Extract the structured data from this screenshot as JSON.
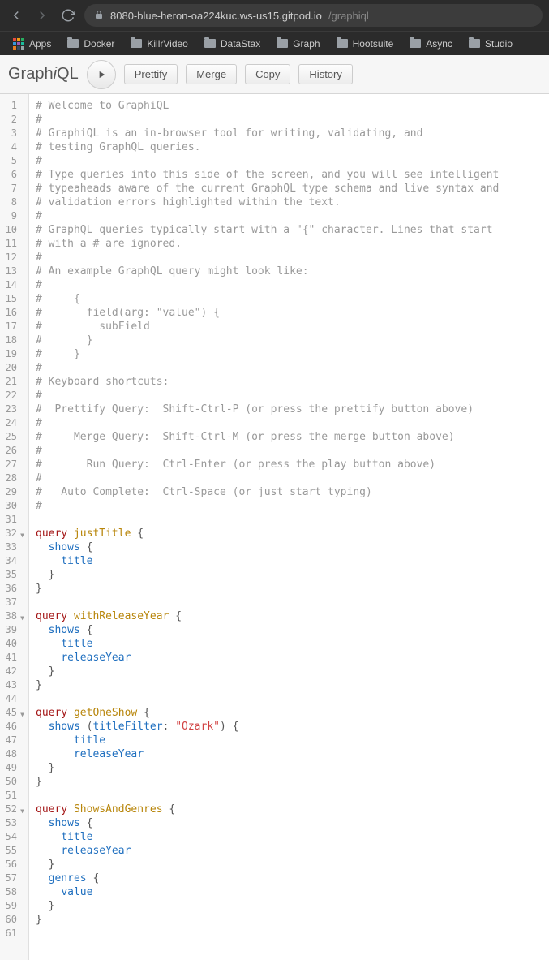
{
  "browser": {
    "url_host": "8080-blue-heron-oa224kuc.ws-us15.gitpod.io",
    "url_path": "/graphiql"
  },
  "bookmarks": [
    {
      "label": "Apps",
      "type": "apps"
    },
    {
      "label": "Docker",
      "type": "folder"
    },
    {
      "label": "KillrVideo",
      "type": "folder"
    },
    {
      "label": "DataStax",
      "type": "folder"
    },
    {
      "label": "Graph",
      "type": "folder"
    },
    {
      "label": "Hootsuite",
      "type": "folder"
    },
    {
      "label": "Async",
      "type": "folder"
    },
    {
      "label": "Studio",
      "type": "folder"
    }
  ],
  "graphiql": {
    "title_prefix": "Graph",
    "title_i": "i",
    "title_suffix": "QL",
    "buttons": {
      "prettify": "Prettify",
      "merge": "Merge",
      "copy": "Copy",
      "history": "History"
    }
  },
  "editor": {
    "line_count": 61,
    "fold_lines": [
      32,
      38,
      45,
      52
    ],
    "lines": [
      [
        {
          "t": "# Welcome to GraphiQL",
          "c": "c-comment"
        }
      ],
      [
        {
          "t": "#",
          "c": "c-comment"
        }
      ],
      [
        {
          "t": "# GraphiQL is an in-browser tool for writing, validating, and",
          "c": "c-comment"
        }
      ],
      [
        {
          "t": "# testing GraphQL queries.",
          "c": "c-comment"
        }
      ],
      [
        {
          "t": "#",
          "c": "c-comment"
        }
      ],
      [
        {
          "t": "# Type queries into this side of the screen, and you will see intelligent",
          "c": "c-comment"
        }
      ],
      [
        {
          "t": "# typeaheads aware of the current GraphQL type schema and live syntax and",
          "c": "c-comment"
        }
      ],
      [
        {
          "t": "# validation errors highlighted within the text.",
          "c": "c-comment"
        }
      ],
      [
        {
          "t": "#",
          "c": "c-comment"
        }
      ],
      [
        {
          "t": "# GraphQL queries typically start with a \"{\" character. Lines that start",
          "c": "c-comment"
        }
      ],
      [
        {
          "t": "# with a # are ignored.",
          "c": "c-comment"
        }
      ],
      [
        {
          "t": "#",
          "c": "c-comment"
        }
      ],
      [
        {
          "t": "# An example GraphQL query might look like:",
          "c": "c-comment"
        }
      ],
      [
        {
          "t": "#",
          "c": "c-comment"
        }
      ],
      [
        {
          "t": "#     {",
          "c": "c-comment"
        }
      ],
      [
        {
          "t": "#       field(arg: \"value\") {",
          "c": "c-comment"
        }
      ],
      [
        {
          "t": "#         subField",
          "c": "c-comment"
        }
      ],
      [
        {
          "t": "#       }",
          "c": "c-comment"
        }
      ],
      [
        {
          "t": "#     }",
          "c": "c-comment"
        }
      ],
      [
        {
          "t": "#",
          "c": "c-comment"
        }
      ],
      [
        {
          "t": "# Keyboard shortcuts:",
          "c": "c-comment"
        }
      ],
      [
        {
          "t": "#",
          "c": "c-comment"
        }
      ],
      [
        {
          "t": "#  Prettify Query:  Shift-Ctrl-P (or press the prettify button above)",
          "c": "c-comment"
        }
      ],
      [
        {
          "t": "#",
          "c": "c-comment"
        }
      ],
      [
        {
          "t": "#     Merge Query:  Shift-Ctrl-M (or press the merge button above)",
          "c": "c-comment"
        }
      ],
      [
        {
          "t": "#",
          "c": "c-comment"
        }
      ],
      [
        {
          "t": "#       Run Query:  Ctrl-Enter (or press the play button above)",
          "c": "c-comment"
        }
      ],
      [
        {
          "t": "#",
          "c": "c-comment"
        }
      ],
      [
        {
          "t": "#   Auto Complete:  Ctrl-Space (or just start typing)",
          "c": "c-comment"
        }
      ],
      [
        {
          "t": "#",
          "c": "c-comment"
        }
      ],
      [],
      [
        {
          "t": "query",
          "c": "c-keyword"
        },
        {
          "t": " ",
          "c": ""
        },
        {
          "t": "justTitle",
          "c": "c-def"
        },
        {
          "t": " {",
          "c": "c-punct"
        }
      ],
      [
        {
          "t": "  ",
          "c": ""
        },
        {
          "t": "shows",
          "c": "c-prop"
        },
        {
          "t": " {",
          "c": "c-punct"
        }
      ],
      [
        {
          "t": "    ",
          "c": ""
        },
        {
          "t": "title",
          "c": "c-prop"
        }
      ],
      [
        {
          "t": "  }",
          "c": "c-punct"
        }
      ],
      [
        {
          "t": "}",
          "c": "c-punct"
        }
      ],
      [],
      [
        {
          "t": "query",
          "c": "c-keyword"
        },
        {
          "t": " ",
          "c": ""
        },
        {
          "t": "withReleaseYear",
          "c": "c-def"
        },
        {
          "t": " {",
          "c": "c-punct"
        }
      ],
      [
        {
          "t": "  ",
          "c": ""
        },
        {
          "t": "shows",
          "c": "c-prop"
        },
        {
          "t": " {",
          "c": "c-punct"
        }
      ],
      [
        {
          "t": "    ",
          "c": ""
        },
        {
          "t": "title",
          "c": "c-prop"
        }
      ],
      [
        {
          "t": "    ",
          "c": ""
        },
        {
          "t": "releaseYear",
          "c": "c-prop"
        }
      ],
      [
        {
          "t": "  }",
          "c": "c-punct",
          "cursor": true
        }
      ],
      [
        {
          "t": "}",
          "c": "c-punct"
        }
      ],
      [],
      [
        {
          "t": "query",
          "c": "c-keyword"
        },
        {
          "t": " ",
          "c": ""
        },
        {
          "t": "getOneShow",
          "c": "c-def"
        },
        {
          "t": " {",
          "c": "c-punct"
        }
      ],
      [
        {
          "t": "  ",
          "c": ""
        },
        {
          "t": "shows",
          "c": "c-prop"
        },
        {
          "t": " (",
          "c": "c-punct"
        },
        {
          "t": "titleFilter",
          "c": "c-attr"
        },
        {
          "t": ": ",
          "c": "c-punct"
        },
        {
          "t": "\"Ozark\"",
          "c": "c-string"
        },
        {
          "t": ") {",
          "c": "c-punct"
        }
      ],
      [
        {
          "t": "      ",
          "c": ""
        },
        {
          "t": "title",
          "c": "c-prop"
        }
      ],
      [
        {
          "t": "      ",
          "c": ""
        },
        {
          "t": "releaseYear",
          "c": "c-prop"
        }
      ],
      [
        {
          "t": "  }",
          "c": "c-punct"
        }
      ],
      [
        {
          "t": "}",
          "c": "c-punct"
        }
      ],
      [],
      [
        {
          "t": "query",
          "c": "c-keyword"
        },
        {
          "t": " ",
          "c": ""
        },
        {
          "t": "ShowsAndGenres",
          "c": "c-def"
        },
        {
          "t": " {",
          "c": "c-punct"
        }
      ],
      [
        {
          "t": "  ",
          "c": ""
        },
        {
          "t": "shows",
          "c": "c-prop"
        },
        {
          "t": " {",
          "c": "c-punct"
        }
      ],
      [
        {
          "t": "    ",
          "c": ""
        },
        {
          "t": "title",
          "c": "c-prop"
        }
      ],
      [
        {
          "t": "    ",
          "c": ""
        },
        {
          "t": "releaseYear",
          "c": "c-prop"
        }
      ],
      [
        {
          "t": "  }",
          "c": "c-punct"
        }
      ],
      [
        {
          "t": "  ",
          "c": ""
        },
        {
          "t": "genres",
          "c": "c-prop"
        },
        {
          "t": " {",
          "c": "c-punct"
        }
      ],
      [
        {
          "t": "    ",
          "c": ""
        },
        {
          "t": "value",
          "c": "c-prop"
        }
      ],
      [
        {
          "t": "  }",
          "c": "c-punct"
        }
      ],
      [
        {
          "t": "}",
          "c": "c-punct"
        }
      ],
      []
    ]
  }
}
